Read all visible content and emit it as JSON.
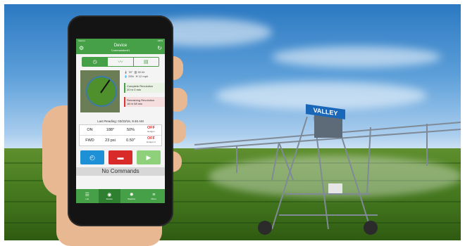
{
  "app": {
    "status_left": "Verizon",
    "status_right": "100%",
    "title": "Device",
    "subtitle": "Commander#1"
  },
  "segments": [
    {
      "icon": "clock-icon",
      "glyph": "◷",
      "active": true
    },
    {
      "icon": "trend-icon",
      "glyph": "〰",
      "active": false
    },
    {
      "icon": "list-icon",
      "glyph": "▤",
      "active": false
    }
  ],
  "weather": {
    "temp": "78°",
    "pressure": "30.04",
    "humidity": "25%",
    "wind": "12 mph"
  },
  "notes": {
    "complete": "Complete Revolution\n20 hr 0 min",
    "remaining": "Remaining Revolution\n18 hr 58 min"
  },
  "last_reading": "Last Reading: 03/23/16, 9:46 AM",
  "readings": [
    {
      "state": "ON",
      "value": "188°",
      "pct": "50%",
      "status": "OFF",
      "sub": "Endgun"
    },
    {
      "state": "FWD",
      "value": "23 psi",
      "pct": "0.50\"",
      "status": "OFF",
      "sub": "Endgun 2"
    }
  ],
  "no_commands": "No Commands",
  "tabs": [
    {
      "label": "List",
      "icon": "list-icon",
      "active": false
    },
    {
      "label": "Device",
      "icon": "device-icon",
      "active": true
    },
    {
      "label": "Weather",
      "icon": "weather-icon",
      "active": false
    },
    {
      "label": "Menu",
      "icon": "menu-icon",
      "active": false
    }
  ],
  "scene": {
    "sign_text": "VALLEY"
  },
  "colors": {
    "brand_green": "#46a047",
    "stop_red": "#d92a2a",
    "info_blue": "#1e90d6"
  }
}
